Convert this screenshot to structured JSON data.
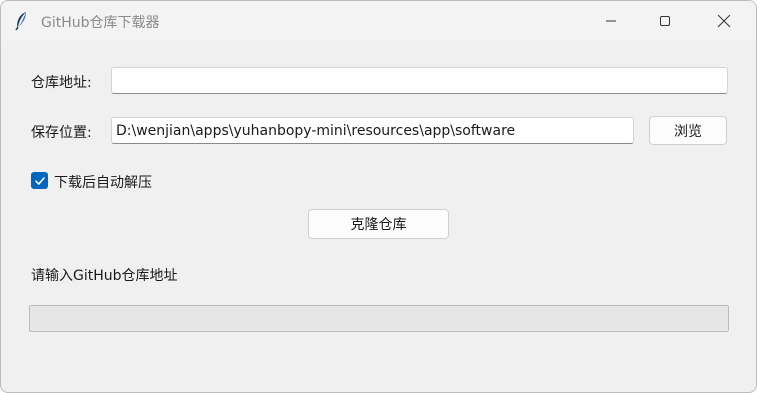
{
  "window": {
    "title": "GitHub仓库下载器",
    "icon": "feather-icon"
  },
  "form": {
    "repo_label": "仓库地址:",
    "repo_value": "",
    "save_label": "保存位置:",
    "save_value": "D:\\wenjian\\apps\\yuhanbopy-mini\\resources\\app\\software",
    "browse_label": "浏览",
    "auto_extract_label": "下载后自动解压",
    "auto_extract_checked": true,
    "clone_label": "克隆仓库"
  },
  "status": {
    "text": "请输入GitHub仓库地址",
    "progress": 0
  },
  "colors": {
    "accent": "#0067c0",
    "window_bg": "#f0f0f0",
    "title_text": "#8a8a8a"
  }
}
